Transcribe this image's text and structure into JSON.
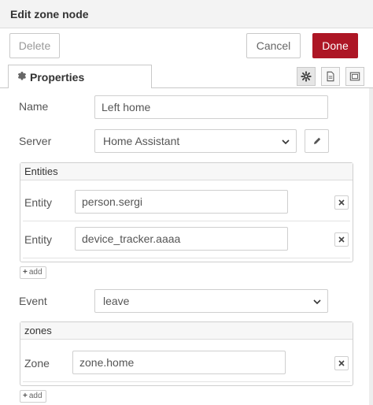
{
  "window": {
    "title": "Edit zone node"
  },
  "buttons": {
    "delete": "Delete",
    "cancel": "Cancel",
    "done": "Done"
  },
  "tabs": {
    "properties": "Properties",
    "icons": [
      "gear-icon",
      "description-icon",
      "appearance-icon"
    ]
  },
  "form": {
    "name": {
      "label": "Name",
      "value": "Left home"
    },
    "server": {
      "label": "Server",
      "value": "Home Assistant"
    },
    "entities": {
      "header": "Entities",
      "rows": [
        {
          "label": "Entity",
          "value": "person.sergi"
        },
        {
          "label": "Entity",
          "value": "device_tracker.aaaa"
        }
      ],
      "add": "add"
    },
    "event": {
      "label": "Event",
      "value": "leave"
    },
    "zones": {
      "header": "zones",
      "rows": [
        {
          "label": "Zone",
          "value": "zone.home"
        }
      ],
      "add": "add"
    }
  },
  "colors": {
    "done": "#ad1625",
    "header_bg": "#f3f3f3",
    "border": "#cfcfcf"
  }
}
